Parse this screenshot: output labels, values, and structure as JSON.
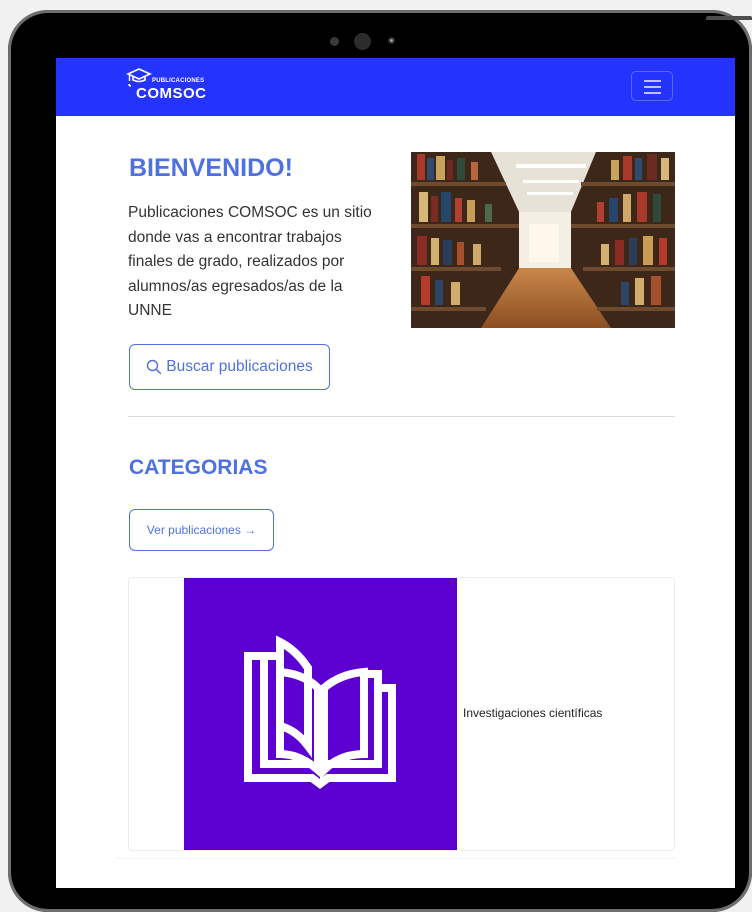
{
  "header": {
    "logo_small": "PUBLICACIONES",
    "logo_big": "COMSOC"
  },
  "welcome": {
    "title": "BIENVENIDO!",
    "text": "Publicaciones COMSOC es un sitio donde vas a encontrar trabajos finales de grado, realizados por alumnos/as egresados/as de la UNNE",
    "search_button": "Buscar publicaciones"
  },
  "categories": {
    "title": "CATEGORIAS",
    "view_button": "Ver publicaciones →",
    "items": [
      {
        "label": "Investigaciones científicas",
        "icon": "open-book-icon",
        "color": "#5c00d2"
      }
    ]
  },
  "colors": {
    "navbar": "#2533ff",
    "accent": "#4f71e0"
  }
}
